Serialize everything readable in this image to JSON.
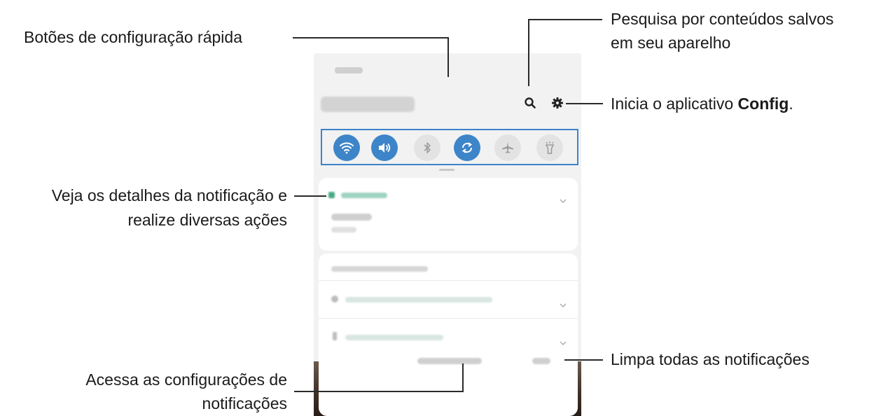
{
  "callouts": {
    "quick_settings": "Botões de configuração rápida",
    "search_line1": "Pesquisa por conteúdos salvos",
    "search_line2": "em seu aparelho",
    "settings_prefix": "Inicia o aplicativo ",
    "settings_app": "Config",
    "settings_suffix": ".",
    "notification_line1": "Veja os detalhes da notificação e",
    "notification_line2": "realize diversas ações",
    "clear_all": "Limpa todas as notificações",
    "notif_settings_line1": "Acessa as configurações de",
    "notif_settings_line2": "notificações"
  },
  "quick_settings_buttons": [
    {
      "name": "wifi",
      "state": "on"
    },
    {
      "name": "sound",
      "state": "on"
    },
    {
      "name": "bluetooth",
      "state": "off"
    },
    {
      "name": "auto-rotate",
      "state": "on"
    },
    {
      "name": "airplane-mode",
      "state": "off"
    },
    {
      "name": "flashlight",
      "state": "off"
    }
  ],
  "colors": {
    "accent": "#3d85c8",
    "frame": "#3b83c9",
    "line": "#2a2a2a"
  }
}
